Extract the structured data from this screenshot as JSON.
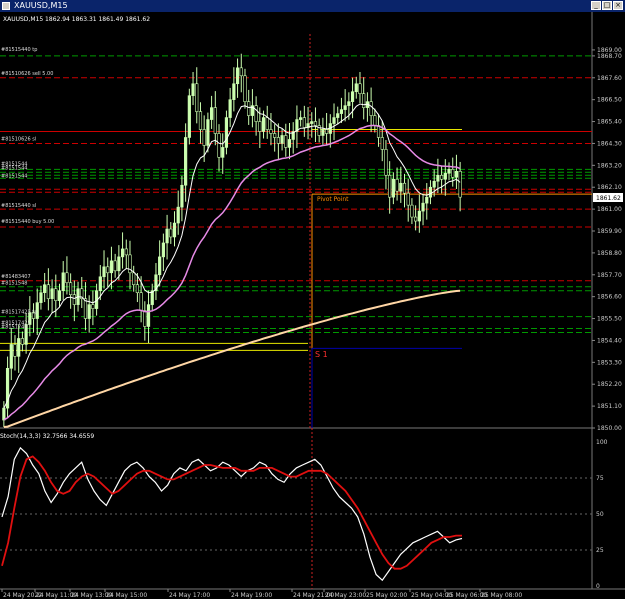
{
  "window": {
    "title": "XAUUSD,M15",
    "min_label": "_",
    "max_label": "□",
    "close_label": "×"
  },
  "chart_info": {
    "ohlc_text": "XAUUSD,M15  1862.94 1863.31 1861.49 1861.62"
  },
  "price_axis": {
    "labels": [
      "1869.00",
      "1868.70",
      "1867.60",
      "1866.50",
      "1865.40",
      "1864.30",
      "1863.20",
      "1862.10",
      "1861.00",
      "1859.90",
      "1858.80",
      "1857.70",
      "1856.60",
      "1855.50",
      "1854.40",
      "1853.30",
      "1852.20",
      "1851.10",
      "1850.00"
    ],
    "current_price": "1861.62",
    "current_price_color": "#ffffff"
  },
  "order_labels": [
    "#81515440 tp",
    "#81510626 sell 5.00",
    "#81510626 sl",
    "#8151544",
    "#8151544",
    "#8151544",
    "#81515440 sl",
    "#81515440 buy 5.00",
    "#81483407",
    "#8151548",
    "#81517425 tp",
    "#81517425",
    "#8151748"
  ],
  "chart_annotations": {
    "pivot_label": "Pivot Point",
    "s1_label": "S 1"
  },
  "indicator": {
    "label": "Stoch(14,3,3) 32.7566 34.6559",
    "axis_labels": [
      "100",
      "75",
      "50",
      "25",
      "0"
    ]
  },
  "time_axis": {
    "labels": [
      "24 May 2022",
      "24 May 11:00",
      "24 May 13:00",
      "24 May 15:00",
      "24 May 17:00",
      "24 May 19:00",
      "24 May 21:00",
      "24 May 23:00",
      "25 May 02:00",
      "25 May 04:00",
      "25 May 06:00",
      "25 May 08:00"
    ]
  },
  "colors": {
    "background": "#000000",
    "bull_candle": "#ccffb0",
    "ma_white": "#ffffff",
    "ma_violet": "#e68ae6",
    "ma_peach": "#ffd6a5",
    "stoch_main": "#ffffff",
    "stoch_signal": "#e01010",
    "order_line": "#cc0000",
    "tp_line": "#009900",
    "pivot_yellow": "#e8e800",
    "pivot_orange": "#ff8c00",
    "s1_blue": "#0000aa"
  },
  "chart_data": [
    {
      "type": "candlestick",
      "title": "XAUUSD,M15",
      "symbol": "XAUUSD",
      "timeframe": "M15",
      "ylim": [
        1850.0,
        1869.8
      ],
      "last_bar": {
        "open": 1862.94,
        "high": 1863.31,
        "low": 1861.49,
        "close": 1861.62
      },
      "closes": [
        1851.0,
        1853.0,
        1854.2,
        1853.6,
        1854.5,
        1854.2,
        1855.2,
        1855.8,
        1855.5,
        1856.3,
        1856.8,
        1857.2,
        1856.5,
        1857.0,
        1856.4,
        1856.9,
        1857.8,
        1857.3,
        1856.7,
        1856.2,
        1857.0,
        1856.5,
        1855.5,
        1856.2,
        1856.0,
        1856.9,
        1857.6,
        1858.1,
        1857.8,
        1858.4,
        1857.9,
        1858.6,
        1859.0,
        1858.7,
        1857.8,
        1857.2,
        1856.8,
        1855.9,
        1855.1,
        1856.2,
        1856.9,
        1857.7,
        1858.6,
        1859.3,
        1860.0,
        1859.6,
        1860.3,
        1861.1,
        1862.2,
        1864.6,
        1866.7,
        1867.3,
        1865.9,
        1865.0,
        1864.2,
        1865.5,
        1866.1,
        1864.8,
        1863.6,
        1864.1,
        1865.6,
        1866.5,
        1867.3,
        1868.1,
        1867.7,
        1866.4,
        1865.7,
        1866.2,
        1865.4,
        1864.9,
        1865.6,
        1865.0,
        1864.8,
        1864.6,
        1864.3,
        1864.7,
        1864.1,
        1864.5,
        1864.9,
        1865.5,
        1865.6,
        1865.1,
        1865.3,
        1865.4,
        1865.2,
        1864.7,
        1865.0,
        1864.8,
        1865.3,
        1865.6,
        1865.8,
        1866.0,
        1866.2,
        1866.4,
        1866.9,
        1867.3,
        1866.8,
        1866.1,
        1866.4,
        1865.7,
        1865.2,
        1864.6,
        1864.0,
        1862.7,
        1861.6,
        1862.5,
        1861.9,
        1862.3,
        1861.8,
        1861.2,
        1860.6,
        1860.4,
        1860.9,
        1861.3,
        1861.6,
        1862.1,
        1862.4,
        1862.7,
        1862.5,
        1862.8,
        1863.0,
        1862.6,
        1862.9,
        1861.6
      ],
      "moving_averages": [
        {
          "color": "#ffffff",
          "values_start_end": [
            1853.4,
            1862.6
          ]
        },
        {
          "color": "#e68ae6",
          "values_start_end": [
            1854.6,
            1863.1
          ]
        },
        {
          "color": "#ffd6a5",
          "values_start_end": [
            1850.0,
            1856.9
          ]
        }
      ],
      "order_levels": [
        {
          "label": "#81515440 tp",
          "price": 1868.7
        },
        {
          "label": "#81510626 sell 5.00",
          "price": 1867.6
        },
        {
          "label": "#81510626 sl",
          "price": 1864.3
        },
        {
          "label": "#81515440 sl",
          "price": 1861.0
        },
        {
          "label": "#81515440 buy 5.00",
          "price": 1860.1
        },
        {
          "label": "#81483407",
          "price": 1857.4
        },
        {
          "label": "#81517425 tp",
          "price": 1855.6
        }
      ],
      "pivot_point": 1861.75,
      "s1": 1854.0
    },
    {
      "type": "line",
      "title": "Stoch(14,3,3)",
      "ylim": [
        0,
        100
      ],
      "series": [
        {
          "name": "Stoch main 32.7566",
          "values": [
            48,
            62,
            88,
            96,
            92,
            84,
            78,
            66,
            58,
            64,
            72,
            78,
            82,
            86,
            74,
            66,
            60,
            56,
            64,
            72,
            80,
            84,
            86,
            82,
            76,
            72,
            66,
            70,
            78,
            82,
            80,
            86,
            88,
            84,
            80,
            82,
            86,
            84,
            80,
            76,
            80,
            82,
            86,
            84,
            78,
            74,
            72,
            78,
            82,
            84,
            86,
            88,
            84,
            76,
            68,
            62,
            58,
            54,
            48,
            36,
            20,
            8,
            4,
            10,
            16,
            22,
            26,
            30,
            32,
            34,
            36,
            38,
            34,
            30,
            32,
            33
          ]
        },
        {
          "name": "Stoch signal 34.6559",
          "values": [
            14,
            30,
            54,
            76,
            88,
            90,
            86,
            80,
            72,
            66,
            64,
            66,
            72,
            76,
            78,
            76,
            72,
            68,
            64,
            66,
            70,
            74,
            78,
            80,
            80,
            78,
            76,
            74,
            74,
            76,
            78,
            80,
            82,
            84,
            84,
            83,
            82,
            82,
            82,
            80,
            80,
            80,
            82,
            82,
            82,
            80,
            78,
            76,
            76,
            78,
            80,
            80,
            80,
            78,
            74,
            70,
            66,
            60,
            54,
            46,
            38,
            30,
            22,
            16,
            12,
            12,
            14,
            18,
            22,
            26,
            30,
            32,
            34,
            34,
            35,
            35
          ]
        }
      ]
    }
  ]
}
